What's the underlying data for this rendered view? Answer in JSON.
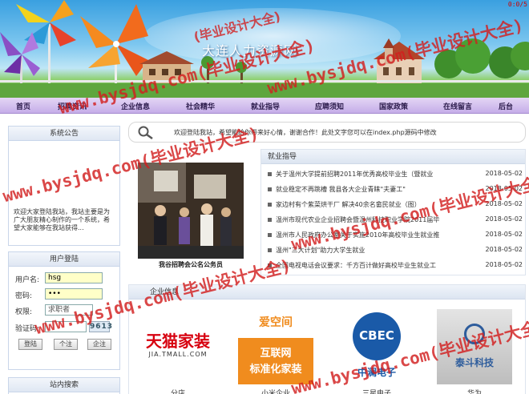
{
  "header": {
    "site_title": "大连人力资源网",
    "counter": "0:0/5"
  },
  "nav": {
    "items": [
      "首页",
      "招聘资讯",
      "企业信息",
      "社会精华",
      "就业指导",
      "应聘须知",
      "国家政策",
      "在线留言",
      "后台"
    ]
  },
  "notice": {
    "title": "系统公告",
    "body": "欢迎大家登陆我站，我站主要是为广大朋友精心制作的一个系统，希望大家能够在我站获得..."
  },
  "welcome": {
    "message": "欢迎登陆我站，希望能给你带来好心情，谢谢合作！此处文字您可以在index.php源码中修改"
  },
  "photo_news": {
    "caption": "我谷招聘会公名公务员"
  },
  "guide": {
    "title": "就业指导",
    "items": [
      {
        "title": "关于温州大学提前招聘2011年优秀高校毕业生（暨就业",
        "date": "2018-05-02"
      },
      {
        "title": "就业稳定不再跳槽 我县各大企业青睐\"夫妻工\"",
        "date": "2018-05-02"
      },
      {
        "title": "家边村有个紫菜烘干厂 解决40余名畲民就业（图）",
        "date": "2018-05-02"
      },
      {
        "title": "温州市现代农业企业招聘会暨温州科技职业学院2011届毕",
        "date": "2018-05-02"
      },
      {
        "title": "温州市人民政府办公室关于实施2010年高校毕业生就业推",
        "date": "2018-05-02"
      },
      {
        "title": "温州\"三大计划\"助力大学生就业",
        "date": "2018-05-02"
      },
      {
        "title": "全国电视电话会议要求：千方百计做好高校毕业生就业工",
        "date": "2018-05-02"
      }
    ]
  },
  "login": {
    "title": "用户登陆",
    "username_label": "用户名:",
    "username_value": "hsg",
    "password_label": "密码:",
    "password_value": "•••",
    "role_label": "权限:",
    "role_value": "求职者",
    "captcha_label": "验证码:",
    "captcha_value": "9613",
    "buttons": [
      "登陆",
      "个注",
      "企注"
    ]
  },
  "search": {
    "title": "站内搜索"
  },
  "enterprise": {
    "title": "企业信息",
    "logos": [
      {
        "line1": "天猫家装",
        "line2": "JIA.TMALL.COM",
        "name": "分店"
      },
      {
        "line1": "爱空间",
        "line2": "互联网",
        "line3": "标准化家装",
        "name": "小米企业"
      },
      {
        "line1": "CBEC",
        "line2": "中澜电子",
        "name": "三星电子"
      },
      {
        "line1": "泰斗科技",
        "name": "华为"
      }
    ]
  },
  "watermark": {
    "text1": "www.bysjdq.com(毕业设计大全)",
    "text2": "(毕业设计大全)"
  },
  "colors": {
    "nav_bg": "#c5ade8",
    "login_input_bg": "#ffffc8",
    "tmall_red": "#d7000f",
    "aikongjian_orange": "#f08c1e",
    "cbec_blue": "#1a5aa8",
    "taidou_blue": "#2d5c9c",
    "watermark_red": "#d21e1e"
  }
}
